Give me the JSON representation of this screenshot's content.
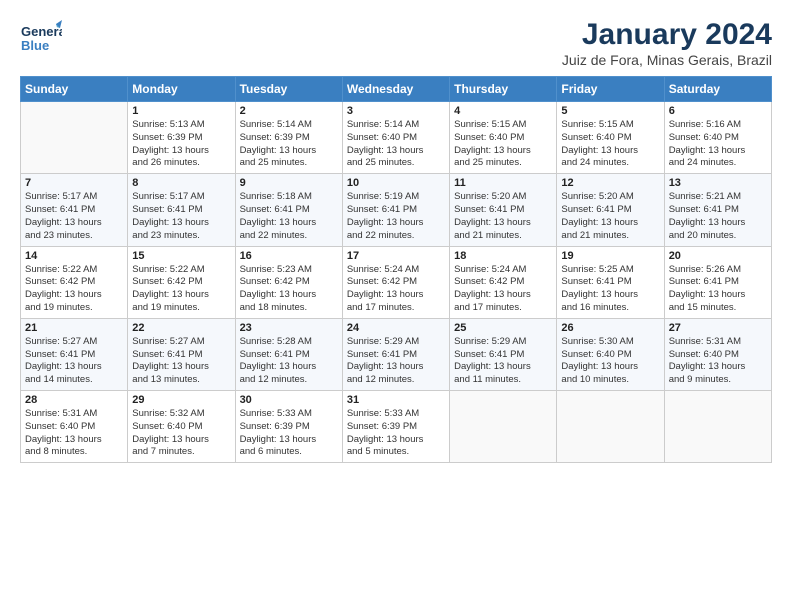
{
  "header": {
    "logo": {
      "general": "General",
      "blue": "Blue"
    },
    "title": "January 2024",
    "subtitle": "Juiz de Fora, Minas Gerais, Brazil"
  },
  "days_of_week": [
    "Sunday",
    "Monday",
    "Tuesday",
    "Wednesday",
    "Thursday",
    "Friday",
    "Saturday"
  ],
  "weeks": [
    [
      {
        "day": "",
        "info": ""
      },
      {
        "day": "1",
        "info": "Sunrise: 5:13 AM\nSunset: 6:39 PM\nDaylight: 13 hours\nand 26 minutes."
      },
      {
        "day": "2",
        "info": "Sunrise: 5:14 AM\nSunset: 6:39 PM\nDaylight: 13 hours\nand 25 minutes."
      },
      {
        "day": "3",
        "info": "Sunrise: 5:14 AM\nSunset: 6:40 PM\nDaylight: 13 hours\nand 25 minutes."
      },
      {
        "day": "4",
        "info": "Sunrise: 5:15 AM\nSunset: 6:40 PM\nDaylight: 13 hours\nand 25 minutes."
      },
      {
        "day": "5",
        "info": "Sunrise: 5:15 AM\nSunset: 6:40 PM\nDaylight: 13 hours\nand 24 minutes."
      },
      {
        "day": "6",
        "info": "Sunrise: 5:16 AM\nSunset: 6:40 PM\nDaylight: 13 hours\nand 24 minutes."
      }
    ],
    [
      {
        "day": "7",
        "info": "Sunrise: 5:17 AM\nSunset: 6:41 PM\nDaylight: 13 hours\nand 23 minutes."
      },
      {
        "day": "8",
        "info": "Sunrise: 5:17 AM\nSunset: 6:41 PM\nDaylight: 13 hours\nand 23 minutes."
      },
      {
        "day": "9",
        "info": "Sunrise: 5:18 AM\nSunset: 6:41 PM\nDaylight: 13 hours\nand 22 minutes."
      },
      {
        "day": "10",
        "info": "Sunrise: 5:19 AM\nSunset: 6:41 PM\nDaylight: 13 hours\nand 22 minutes."
      },
      {
        "day": "11",
        "info": "Sunrise: 5:20 AM\nSunset: 6:41 PM\nDaylight: 13 hours\nand 21 minutes."
      },
      {
        "day": "12",
        "info": "Sunrise: 5:20 AM\nSunset: 6:41 PM\nDaylight: 13 hours\nand 21 minutes."
      },
      {
        "day": "13",
        "info": "Sunrise: 5:21 AM\nSunset: 6:41 PM\nDaylight: 13 hours\nand 20 minutes."
      }
    ],
    [
      {
        "day": "14",
        "info": "Sunrise: 5:22 AM\nSunset: 6:42 PM\nDaylight: 13 hours\nand 19 minutes."
      },
      {
        "day": "15",
        "info": "Sunrise: 5:22 AM\nSunset: 6:42 PM\nDaylight: 13 hours\nand 19 minutes."
      },
      {
        "day": "16",
        "info": "Sunrise: 5:23 AM\nSunset: 6:42 PM\nDaylight: 13 hours\nand 18 minutes."
      },
      {
        "day": "17",
        "info": "Sunrise: 5:24 AM\nSunset: 6:42 PM\nDaylight: 13 hours\nand 17 minutes."
      },
      {
        "day": "18",
        "info": "Sunrise: 5:24 AM\nSunset: 6:42 PM\nDaylight: 13 hours\nand 17 minutes."
      },
      {
        "day": "19",
        "info": "Sunrise: 5:25 AM\nSunset: 6:41 PM\nDaylight: 13 hours\nand 16 minutes."
      },
      {
        "day": "20",
        "info": "Sunrise: 5:26 AM\nSunset: 6:41 PM\nDaylight: 13 hours\nand 15 minutes."
      }
    ],
    [
      {
        "day": "21",
        "info": "Sunrise: 5:27 AM\nSunset: 6:41 PM\nDaylight: 13 hours\nand 14 minutes."
      },
      {
        "day": "22",
        "info": "Sunrise: 5:27 AM\nSunset: 6:41 PM\nDaylight: 13 hours\nand 13 minutes."
      },
      {
        "day": "23",
        "info": "Sunrise: 5:28 AM\nSunset: 6:41 PM\nDaylight: 13 hours\nand 12 minutes."
      },
      {
        "day": "24",
        "info": "Sunrise: 5:29 AM\nSunset: 6:41 PM\nDaylight: 13 hours\nand 12 minutes."
      },
      {
        "day": "25",
        "info": "Sunrise: 5:29 AM\nSunset: 6:41 PM\nDaylight: 13 hours\nand 11 minutes."
      },
      {
        "day": "26",
        "info": "Sunrise: 5:30 AM\nSunset: 6:40 PM\nDaylight: 13 hours\nand 10 minutes."
      },
      {
        "day": "27",
        "info": "Sunrise: 5:31 AM\nSunset: 6:40 PM\nDaylight: 13 hours\nand 9 minutes."
      }
    ],
    [
      {
        "day": "28",
        "info": "Sunrise: 5:31 AM\nSunset: 6:40 PM\nDaylight: 13 hours\nand 8 minutes."
      },
      {
        "day": "29",
        "info": "Sunrise: 5:32 AM\nSunset: 6:40 PM\nDaylight: 13 hours\nand 7 minutes."
      },
      {
        "day": "30",
        "info": "Sunrise: 5:33 AM\nSunset: 6:39 PM\nDaylight: 13 hours\nand 6 minutes."
      },
      {
        "day": "31",
        "info": "Sunrise: 5:33 AM\nSunset: 6:39 PM\nDaylight: 13 hours\nand 5 minutes."
      },
      {
        "day": "",
        "info": ""
      },
      {
        "day": "",
        "info": ""
      },
      {
        "day": "",
        "info": ""
      }
    ]
  ]
}
